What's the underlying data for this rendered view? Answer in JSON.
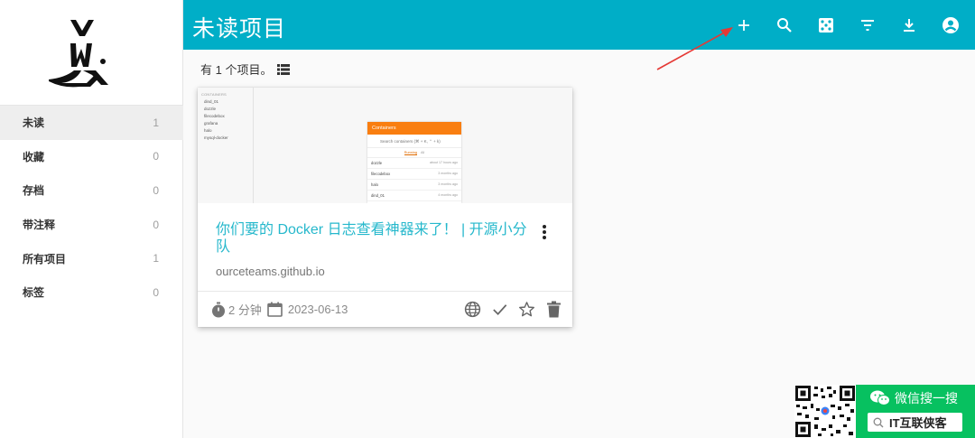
{
  "header": {
    "title": "未读项目"
  },
  "sidebar": {
    "items": [
      {
        "label": "未读",
        "count": "1"
      },
      {
        "label": "收藏",
        "count": "0"
      },
      {
        "label": "存档",
        "count": "0"
      },
      {
        "label": "带注释",
        "count": "0"
      },
      {
        "label": "所有项目",
        "count": "1"
      },
      {
        "label": "标签",
        "count": "0"
      }
    ]
  },
  "main": {
    "count_text": "有 1 个项目。"
  },
  "card": {
    "title": "你们要的 Docker 日志查看神器来了！ | 开源小分队",
    "domain": "ourceteams.github.io",
    "reading_time": "2 分钟",
    "date": "2023-06-13",
    "thumbnail": {
      "side_title": "CONTAINERS",
      "side_items": [
        "dind_01",
        "dozzle",
        "filecodebox",
        "grafana",
        "halo",
        "mysql-docker"
      ],
      "dialog_title": "Containers",
      "search_placeholder": "Search containers (⌘ + K, ⌃ + k)",
      "tab_running": "Running",
      "tab_all": "All",
      "rows": [
        {
          "name": "dozzle",
          "time": "about 17 hours ago"
        },
        {
          "name": "filecodebox",
          "time": "3 months ago"
        },
        {
          "name": "halo",
          "time": "3 months ago"
        },
        {
          "name": "dind_01",
          "time": "4 months ago"
        }
      ]
    }
  },
  "watermark": {
    "label": "微信搜一搜",
    "search_text": "IT互联侠客"
  },
  "colors": {
    "header": "#00aec7",
    "title_link": "#26b8cc",
    "wechat_green": "#07c160",
    "arrow": "#e53935"
  },
  "icons": {
    "header": [
      "plus-icon",
      "search-icon",
      "dice-icon",
      "filter-icon",
      "download-icon",
      "account-icon"
    ],
    "card_actions": [
      "globe-icon",
      "check-icon",
      "star-icon",
      "trash-icon"
    ]
  }
}
